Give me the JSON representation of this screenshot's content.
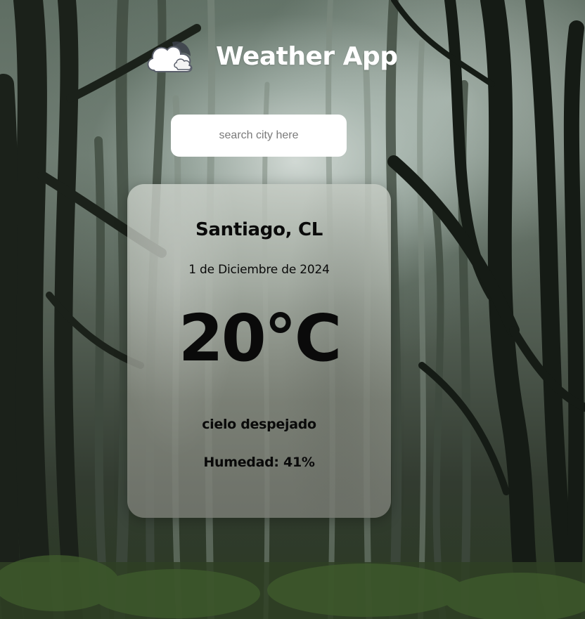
{
  "header": {
    "title": "Weather App",
    "icon": "cloud-sun-icon"
  },
  "search": {
    "placeholder": "search city here",
    "value": ""
  },
  "weather": {
    "city": "Santiago, CL",
    "date": "1 de Diciembre de 2024",
    "temperature": "20°C",
    "description": "cielo despejado",
    "humidity": "Humedad: 41%"
  },
  "colors": {
    "title_text": "#ffffff",
    "search_background": "#ffffff",
    "card_text": "#0a0a0a"
  }
}
